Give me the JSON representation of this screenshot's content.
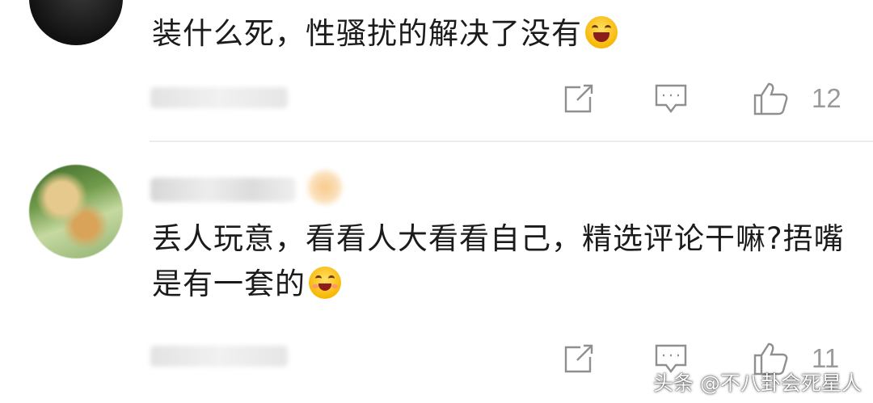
{
  "comments": [
    {
      "text": "装什么死，性骚扰的解决了没有",
      "emoji": "grinning-face-emoji",
      "likes": "12"
    },
    {
      "text": "丢人玩意，看看人大看看自己，精选评论干嘛?捂嘴是有一套的",
      "emoji": "smiling-blush-emoji",
      "likes": "11"
    }
  ],
  "watermark": "头条 @不八卦会死星人",
  "icons": {
    "share": "edit-share-icon",
    "reply": "comment-bubble-icon",
    "like": "thumbs-up-icon"
  },
  "colors": {
    "text": "#1b1b1b",
    "icon": "#8f8f8f",
    "divider": "#ececec"
  }
}
